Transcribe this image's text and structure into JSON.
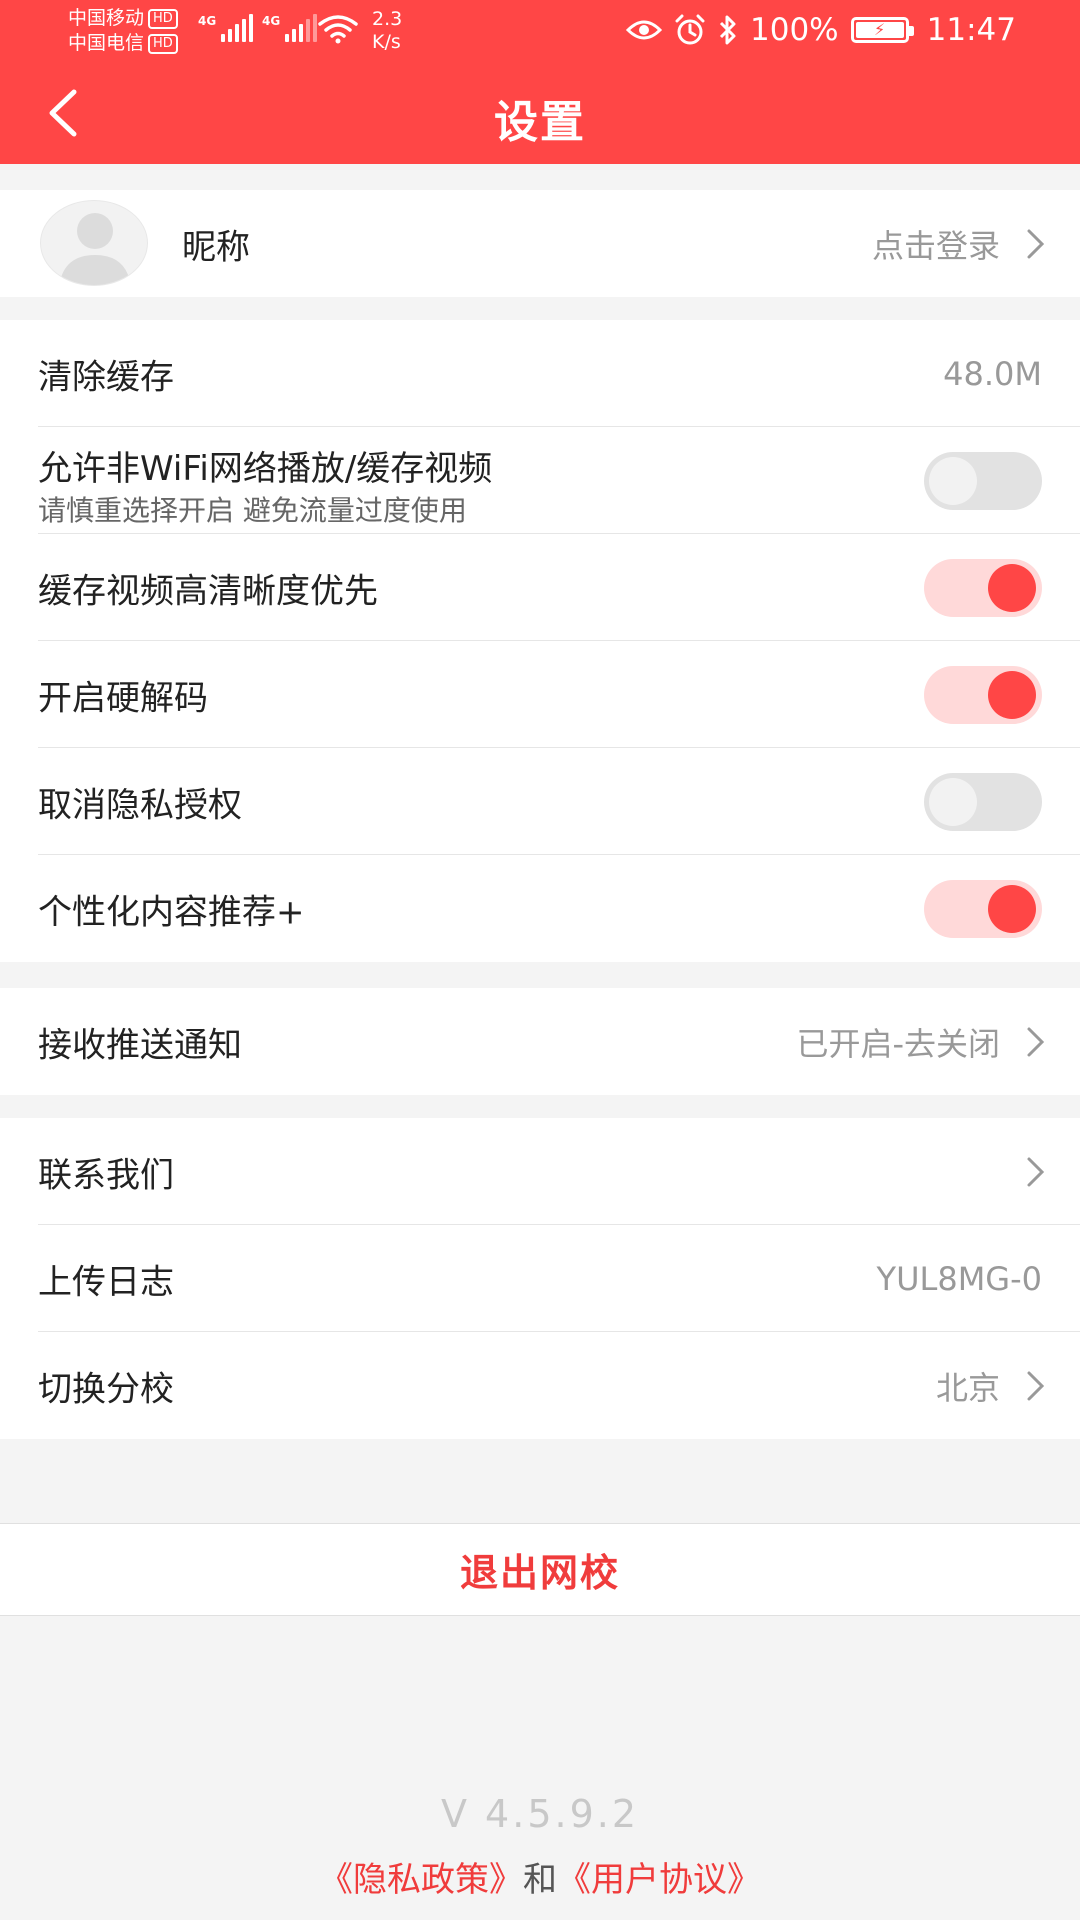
{
  "status_bar": {
    "carrier1": "中国移动",
    "carrier2": "中国电信",
    "hd": "HD",
    "net1": "4G",
    "net2": "4G",
    "speed_value": "2.3",
    "speed_unit": "K/s",
    "battery": "100%",
    "time": "11:47"
  },
  "header": {
    "title": "设置"
  },
  "profile": {
    "nickname": "昵称",
    "login": "点击登录"
  },
  "settings": {
    "clear_cache": {
      "label": "清除缓存",
      "value": "48.0M"
    },
    "non_wifi": {
      "label": "允许非WiFi网络播放/缓存视频",
      "sub": "请慎重选择开启 避免流量过度使用",
      "on": false
    },
    "hd_first": {
      "label": "缓存视频高清晰度优先",
      "on": true
    },
    "hw_decode": {
      "label": "开启硬解码",
      "on": true
    },
    "privacy": {
      "label": "取消隐私授权",
      "on": false
    },
    "personal": {
      "label": "个性化内容推荐+",
      "on": true
    }
  },
  "push": {
    "label": "接收推送通知",
    "value": "已开启-去关闭"
  },
  "more": {
    "contact": {
      "label": "联系我们"
    },
    "upload_log": {
      "label": "上传日志",
      "value": "YUL8MG-0"
    },
    "campus": {
      "label": "切换分校",
      "value": "北京"
    }
  },
  "logout": "退出网校",
  "footer": {
    "version": "V 4.5.9.2",
    "privacy_link": "《隐私政策》",
    "and": "和",
    "terms_link": "《用户协议》"
  },
  "colors": {
    "accent": "#ff4646",
    "toggle_on_track": "#ffd9d9",
    "toggle_off_track": "#e2e2e2"
  }
}
